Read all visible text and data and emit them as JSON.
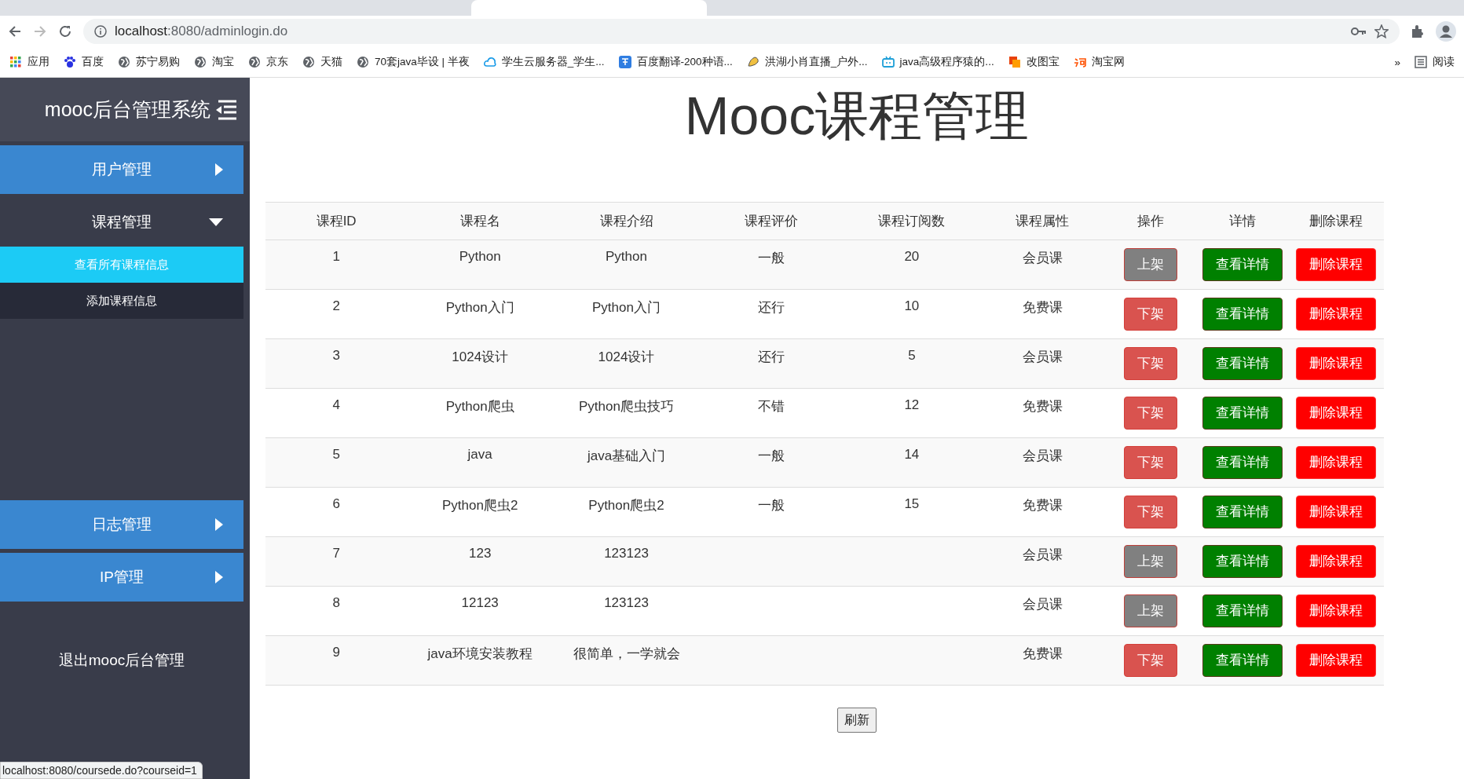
{
  "browser": {
    "url_host": "localhost",
    "url_rest": ":8080/adminlogin.do",
    "bookmarks": [
      {
        "label": "应用"
      },
      {
        "label": "百度"
      },
      {
        "label": "苏宁易购"
      },
      {
        "label": "淘宝"
      },
      {
        "label": "京东"
      },
      {
        "label": "天猫"
      },
      {
        "label": "70套java毕设 | 半夜"
      },
      {
        "label": "学生云服务器_学生..."
      },
      {
        "label": "百度翻译-200种语..."
      },
      {
        "label": "洪湖小肖直播_户外..."
      },
      {
        "label": "java高级程序猿的..."
      },
      {
        "label": "改图宝"
      },
      {
        "label": "淘宝网"
      }
    ],
    "more": "»",
    "reading_list": "阅读"
  },
  "sidebar": {
    "title": "mooc后台管理系统",
    "menus": [
      {
        "label": "用户管理",
        "expanded": false
      },
      {
        "label": "课程管理",
        "expanded": true,
        "children": [
          {
            "label": "查看所有课程信息",
            "selected": true
          },
          {
            "label": "添加课程信息",
            "selected": false
          }
        ]
      },
      {
        "label": "日志管理",
        "expanded": false
      },
      {
        "label": "IP管理",
        "expanded": false
      }
    ],
    "logout": "退出mooc后台管理"
  },
  "page_title": "Mooc课程管理",
  "table": {
    "columns": [
      "课程ID",
      "课程名",
      "课程介绍",
      "课程评价",
      "课程订阅数",
      "课程属性",
      "操作",
      "详情",
      "删除课程"
    ],
    "rows": [
      {
        "id": "1",
        "name": "Python",
        "intro": "Python",
        "rating": "一般",
        "subs": "20",
        "type": "会员课",
        "status_button": "上架",
        "listed": false,
        "detail_button": "查看详情",
        "delete_button": "删除课程"
      },
      {
        "id": "2",
        "name": "Python入门",
        "intro": "Python入门",
        "rating": "还行",
        "subs": "10",
        "type": "免费课",
        "status_button": "下架",
        "listed": true,
        "detail_button": "查看详情",
        "delete_button": "删除课程"
      },
      {
        "id": "3",
        "name": "1024设计",
        "intro": "1024设计",
        "rating": "还行",
        "subs": "5",
        "type": "会员课",
        "status_button": "下架",
        "listed": true,
        "detail_button": "查看详情",
        "delete_button": "删除课程"
      },
      {
        "id": "4",
        "name": "Python爬虫",
        "intro": "Python爬虫技巧",
        "rating": "不错",
        "subs": "12",
        "type": "免费课",
        "status_button": "下架",
        "listed": true,
        "detail_button": "查看详情",
        "delete_button": "删除课程"
      },
      {
        "id": "5",
        "name": "java",
        "intro": "java基础入门",
        "rating": "一般",
        "subs": "14",
        "type": "会员课",
        "status_button": "下架",
        "listed": true,
        "detail_button": "查看详情",
        "delete_button": "删除课程"
      },
      {
        "id": "6",
        "name": "Python爬虫2",
        "intro": "Python爬虫2",
        "rating": "一般",
        "subs": "15",
        "type": "免费课",
        "status_button": "下架",
        "listed": true,
        "detail_button": "查看详情",
        "delete_button": "删除课程"
      },
      {
        "id": "7",
        "name": "123",
        "intro": "123123",
        "type": "会员课",
        "status_button": "上架",
        "listed": false,
        "detail_button": "查看详情",
        "delete_button": "删除课程"
      },
      {
        "id": "8",
        "name": "12123",
        "intro": "123123",
        "type": "会员课",
        "status_button": "上架",
        "listed": false,
        "detail_button": "查看详情",
        "delete_button": "删除课程"
      },
      {
        "id": "9",
        "name": "java环境安装教程",
        "intro": "很简单，一学就会",
        "type": "免费课",
        "status_button": "下架",
        "listed": true,
        "detail_button": "查看详情",
        "delete_button": "删除课程"
      }
    ]
  },
  "refresh_button": "刷新",
  "status_url": "localhost:8080/coursede.do?courseid=1"
}
